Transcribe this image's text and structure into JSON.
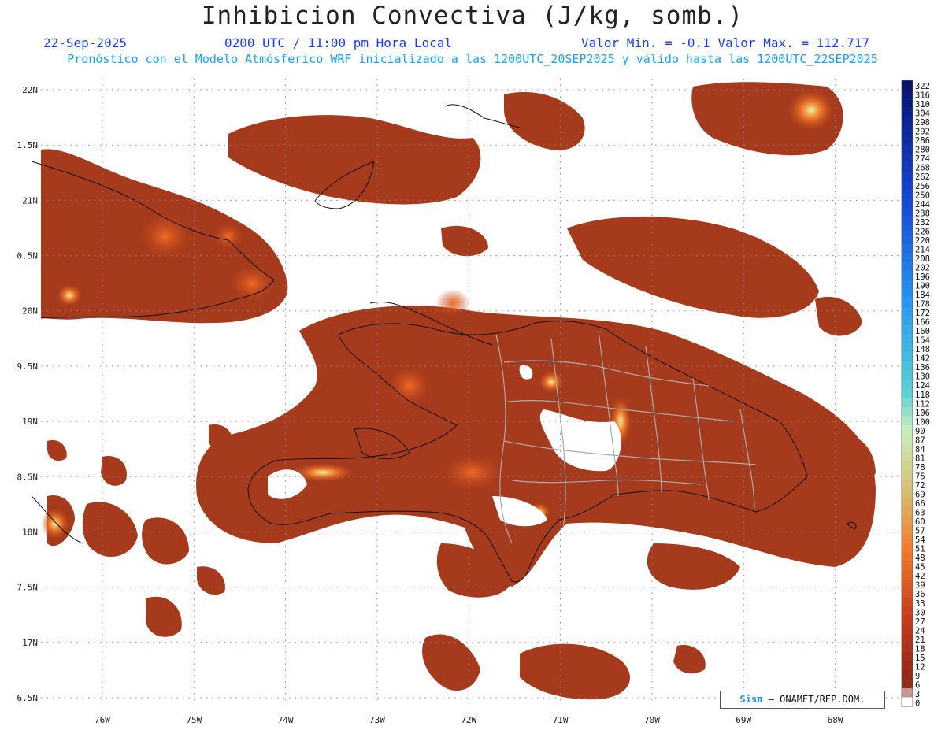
{
  "title": "Inhibicion Convectiva (J/kg, somb.)",
  "date": "22-Sep-2025",
  "time": "0200 UTC / 11:00 pm Hora Local",
  "minmax": "Valor Min. = -0.1  Valor Max. = 112.717",
  "subtitle": "Pronóstico con el Modelo Atmósferico WRF inicializado a las 1200UTC_20SEP2025 y válido hasta las  1200UTC_22SEP2025",
  "credit": {
    "brand": "Sisπ",
    "text": "– ONAMET/REP.DOM."
  },
  "map": {
    "lon_range": [
      -76.67,
      -67.3
    ],
    "lat_range": [
      16.45,
      22.1
    ],
    "lat_labels": [
      "22N",
      "1.5N",
      "21N",
      "0.5N",
      "20N",
      "9.5N",
      "19N",
      "8.5N",
      "18N",
      "7.5N",
      "17N",
      "6.5N"
    ],
    "lat_values": [
      22.0,
      21.5,
      21.0,
      20.5,
      20.0,
      19.5,
      19.0,
      18.5,
      18.0,
      17.5,
      17.0,
      16.5
    ],
    "lon_labels": [
      "76W",
      "75W",
      "74W",
      "73W",
      "72W",
      "71W",
      "70W",
      "69W",
      "68W"
    ],
    "lon_values": [
      -76,
      -75,
      -74,
      -73,
      -72,
      -71,
      -70,
      -69,
      -68
    ],
    "field_color": "#a63a1c"
  },
  "colorbar": {
    "labels": [
      "322",
      "316",
      "310",
      "304",
      "298",
      "292",
      "286",
      "280",
      "274",
      "268",
      "262",
      "256",
      "250",
      "244",
      "238",
      "232",
      "226",
      "220",
      "214",
      "208",
      "202",
      "196",
      "190",
      "184",
      "178",
      "172",
      "166",
      "160",
      "154",
      "148",
      "142",
      "136",
      "130",
      "124",
      "118",
      "112",
      "106",
      "100",
      "90",
      "87",
      "84",
      "81",
      "78",
      "75",
      "72",
      "69",
      "66",
      "63",
      "60",
      "57",
      "54",
      "51",
      "48",
      "45",
      "42",
      "39",
      "36",
      "33",
      "30",
      "27",
      "24",
      "21",
      "18",
      "15",
      "12",
      "9",
      "6",
      "3",
      "0"
    ]
  }
}
